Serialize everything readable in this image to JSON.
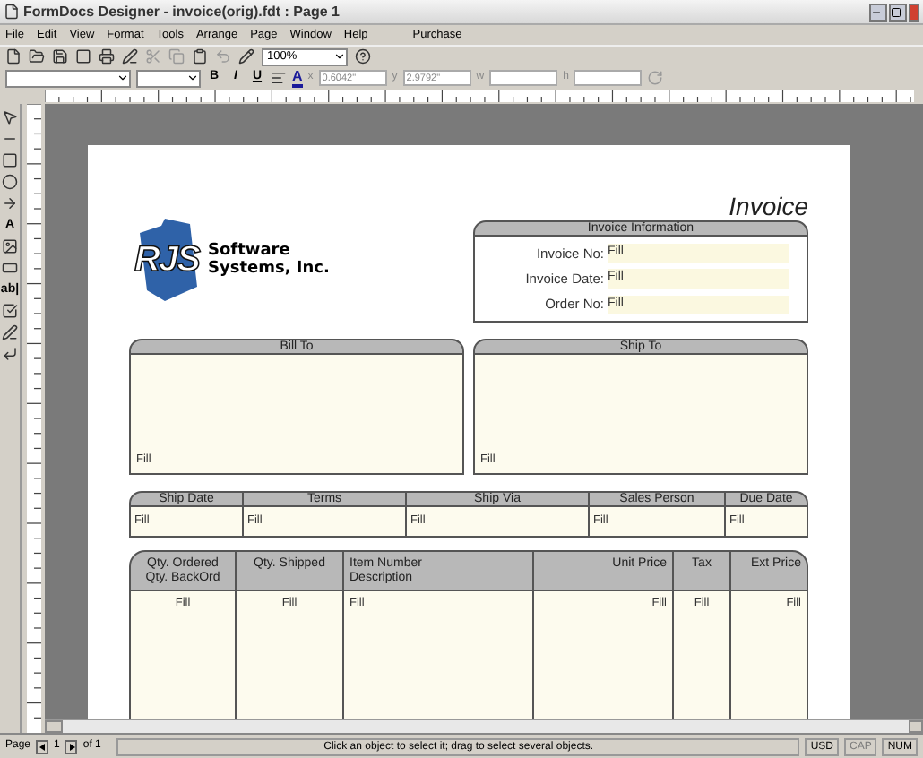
{
  "window": {
    "title": "FormDocs Designer - invoice(orig).fdt : Page 1"
  },
  "menu": [
    "File",
    "Edit",
    "View",
    "Format",
    "Tools",
    "Arrange",
    "Page",
    "Window",
    "Help",
    "Purchase"
  ],
  "toolbar": {
    "zoom": "100%",
    "bold": "B",
    "italic": "I",
    "underline": "U",
    "font_color": "A",
    "x_label": "x",
    "x_value": "0.6042\"",
    "y_label": "y",
    "y_value": "2.9792\"",
    "w_label": "w",
    "h_label": "h"
  },
  "tools": [
    {
      "kind": "pointer"
    },
    {
      "kind": "line"
    },
    {
      "kind": "rectangle"
    },
    {
      "kind": "ellipse"
    },
    {
      "kind": "arrow"
    },
    {
      "kind": "text",
      "label": "A"
    },
    {
      "kind": "image"
    },
    {
      "kind": "box"
    },
    {
      "kind": "text",
      "label": "ab|"
    },
    {
      "kind": "check"
    },
    {
      "kind": "signature"
    },
    {
      "kind": "corner"
    }
  ],
  "document": {
    "title": "Invoice",
    "logo": {
      "mark": "RJS",
      "line_1": "Software",
      "line_2": "Systems, Inc."
    },
    "invoice_info": {
      "heading": "Invoice Information",
      "fields": [
        {
          "label": "Invoice No:",
          "value": "Fill"
        },
        {
          "label": "Invoice Date:",
          "value": "Fill"
        },
        {
          "label": "Order No:",
          "value": "Fill"
        }
      ]
    },
    "bill_to": {
      "heading": "Bill To",
      "value": "Fill"
    },
    "ship_to": {
      "heading": "Ship To",
      "value": "Fill"
    },
    "ship_row": [
      {
        "heading": "Ship Date",
        "value": "Fill"
      },
      {
        "heading": "Terms",
        "value": "Fill"
      },
      {
        "heading": "Ship Via",
        "value": "Fill"
      },
      {
        "heading": "Sales Person",
        "value": "Fill"
      },
      {
        "heading": "Due Date",
        "value": "Fill"
      }
    ],
    "items": [
      {
        "heading": [
          "Qty. Ordered",
          "Qty. BackOrd"
        ],
        "value": "Fill"
      },
      {
        "heading": [
          "Qty. Shipped"
        ],
        "value": "Fill"
      },
      {
        "heading": [
          "Item Number",
          "Description"
        ],
        "value": "Fill"
      },
      {
        "heading": [
          "Unit Price"
        ],
        "value": "Fill"
      },
      {
        "heading": [
          "Tax"
        ],
        "value": "Fill"
      },
      {
        "heading": [
          "Ext Price"
        ],
        "value": "Fill"
      }
    ]
  },
  "status_bar": {
    "page_label": "Page",
    "page": "1",
    "page_total": "of 1",
    "message": "Click an object to select it; drag to select several objects.",
    "indicators": [
      {
        "label": "USD",
        "disabled": false
      },
      {
        "label": "CAP",
        "disabled": true
      },
      {
        "label": "NUM",
        "disabled": false
      }
    ]
  }
}
